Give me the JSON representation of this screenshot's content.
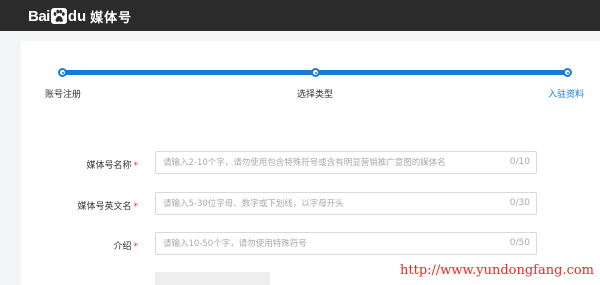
{
  "header": {
    "logo_bai": "Bai",
    "logo_du": "du",
    "logo_sub": "媒体号"
  },
  "steps": [
    {
      "label": "账号注册",
      "active": false
    },
    {
      "label": "选择类型",
      "active": false
    },
    {
      "label": "入驻资料",
      "active": true
    }
  ],
  "form": {
    "fields": [
      {
        "label": "媒体号名称",
        "required": "*",
        "placeholder": "请输入2-10个字，请勿使用包含特殊符号或含有明显营销推广意图的媒体名",
        "value": "",
        "counter": "0/10"
      },
      {
        "label": "媒体号英文名",
        "required": "*",
        "placeholder": "请输入5-30位字母、数字或下划线，以字母开头",
        "value": "",
        "counter": "0/30"
      },
      {
        "label": "介绍",
        "required": "*",
        "placeholder": "请输入10-50个字，请勿使用特殊符号",
        "value": "",
        "counter": "0/50"
      }
    ]
  },
  "watermark": "http://www.yundongfang.com",
  "colors": {
    "accent": "#1a7ad8",
    "header_bg": "#2b2b2b",
    "required": "#e53935",
    "watermark": "#ff1f1f"
  }
}
